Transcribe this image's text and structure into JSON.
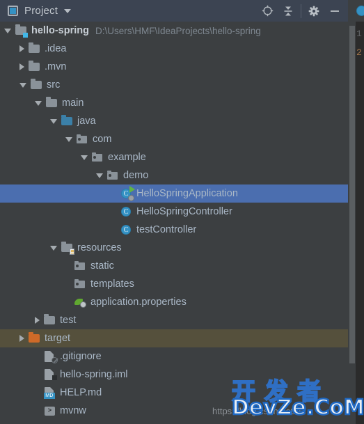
{
  "window": {
    "tool_window_title": "Project",
    "icons": {
      "project_view_icon": "project-window-icon",
      "dropdown_icon": "chevron-down-icon",
      "locate_icon": "scroll-from-source-icon",
      "collapse_icon": "collapse-all-icon",
      "settings_icon": "gear-icon",
      "hide_icon": "minimize-icon"
    }
  },
  "tree": {
    "rows": [
      {
        "label": "hello-spring",
        "path": "D:\\Users\\HMF\\IdeaProjects\\hello-spring",
        "depth": 0,
        "state": "expanded",
        "icon": "module-folder-icon",
        "bold": true
      },
      {
        "label": ".idea",
        "depth": 1,
        "state": "collapsed",
        "icon": "folder-icon"
      },
      {
        "label": ".mvn",
        "depth": 1,
        "state": "collapsed",
        "icon": "folder-icon"
      },
      {
        "label": "src",
        "depth": 1,
        "state": "expanded",
        "icon": "folder-icon"
      },
      {
        "label": "main",
        "depth": 2,
        "state": "expanded",
        "icon": "folder-icon"
      },
      {
        "label": "java",
        "depth": 3,
        "state": "expanded",
        "icon": "source-root-folder-icon"
      },
      {
        "label": "com",
        "depth": 4,
        "state": "expanded",
        "icon": "package-icon"
      },
      {
        "label": "example",
        "depth": 5,
        "state": "expanded",
        "icon": "package-icon"
      },
      {
        "label": "demo",
        "depth": 6,
        "state": "expanded",
        "icon": "package-icon"
      },
      {
        "label": "HelloSpringApplication",
        "depth": 7,
        "state": "leaf",
        "icon": "java-class-runnable-icon",
        "selected": true
      },
      {
        "label": "HelloSpringController",
        "depth": 7,
        "state": "leaf",
        "icon": "java-class-icon"
      },
      {
        "label": "testController",
        "depth": 7,
        "state": "leaf",
        "icon": "java-class-icon"
      },
      {
        "label": "resources",
        "depth": 3,
        "state": "expanded",
        "icon": "resource-root-folder-icon"
      },
      {
        "label": "static",
        "depth": 4,
        "state": "leaf",
        "icon": "package-icon"
      },
      {
        "label": "templates",
        "depth": 4,
        "state": "leaf",
        "icon": "package-icon"
      },
      {
        "label": "application.properties",
        "depth": 4,
        "state": "leaf",
        "icon": "spring-properties-icon"
      },
      {
        "label": "test",
        "depth": 2,
        "state": "collapsed",
        "icon": "folder-icon"
      },
      {
        "label": "target",
        "depth": 1,
        "state": "collapsed",
        "icon": "excluded-folder-icon",
        "hovered": true
      },
      {
        "label": ".gitignore",
        "depth": 2,
        "state": "leaf",
        "icon": "ignored-file-icon"
      },
      {
        "label": "hello-spring.iml",
        "depth": 2,
        "state": "leaf",
        "icon": "iml-file-icon"
      },
      {
        "label": "HELP.md",
        "depth": 2,
        "state": "leaf",
        "icon": "markdown-file-icon",
        "badge_text": "MD"
      },
      {
        "label": "mvnw",
        "depth": 2,
        "state": "leaf",
        "icon": "shell-script-icon",
        "badge_text": ">"
      }
    ]
  },
  "editor": {
    "line_numbers": [
      "1",
      "2"
    ]
  },
  "watermark": {
    "url": "https://blog.csdn.net/h",
    "cn_text": "开发者",
    "en_text": "DevZe.CoM"
  },
  "colors": {
    "titlebar_bg": "#3C4452",
    "panel_bg": "#3C3F41",
    "selection_bg": "#4B6EAF",
    "hover_bg": "#55503C",
    "text": "#A9B7C6",
    "path_text": "#7E8790",
    "accent_blue": "#3592C4",
    "accent_orange": "#CE6A28",
    "accent_green": "#62B543"
  }
}
